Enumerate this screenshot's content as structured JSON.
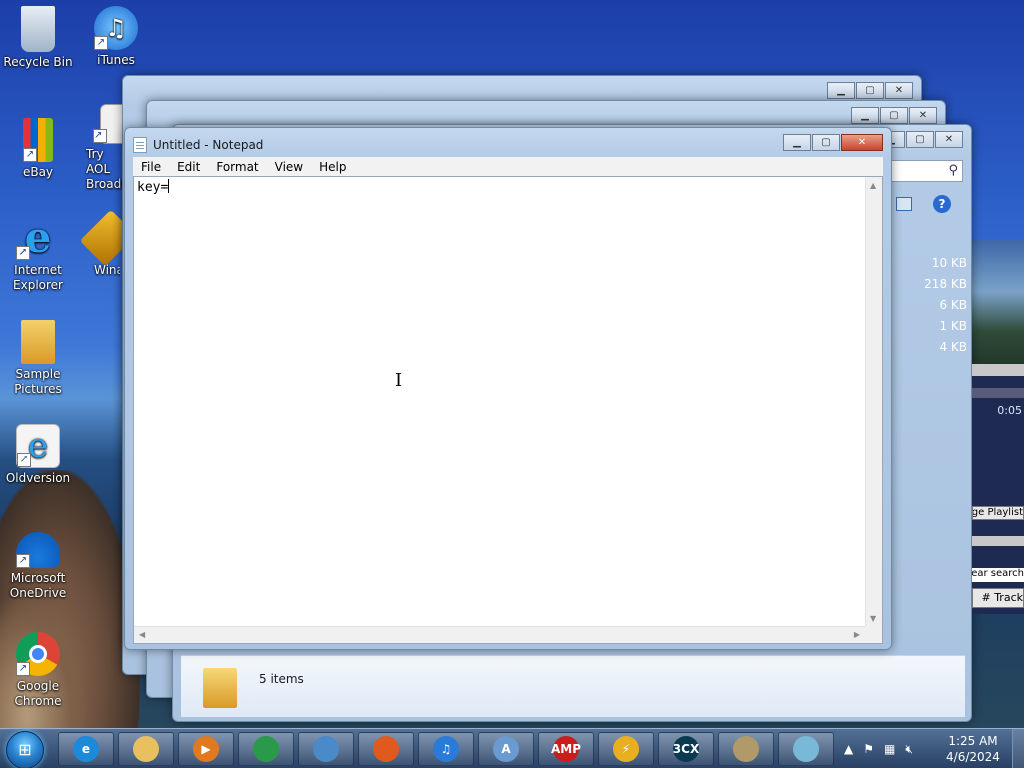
{
  "desktop": {
    "icons": [
      {
        "label": "Recycle Bin"
      },
      {
        "label": "iTunes"
      },
      {
        "label": "eBay"
      },
      {
        "label": "Try AOL Broadband"
      },
      {
        "label": "Internet Explorer"
      },
      {
        "label": "Winamp"
      },
      {
        "label": "Sample Pictures"
      },
      {
        "label": "Oldversion"
      },
      {
        "label": "Microsoft OneDrive"
      },
      {
        "label": "Google Chrome"
      }
    ]
  },
  "notepad": {
    "title": "Untitled - Notepad",
    "menu": [
      "File",
      "Edit",
      "Format",
      "View",
      "Help"
    ],
    "content": "key="
  },
  "explorer": {
    "file_sizes": [
      "10 KB",
      "218 KB",
      "6 KB",
      "1 KB",
      "4 KB"
    ],
    "status": "5 items"
  },
  "winamp": {
    "time": "0:05",
    "manage_playlist": "Manage Playlist",
    "clear_search": "Clear search",
    "track_col": "Track #"
  },
  "taskbar": {
    "items": [
      {
        "icon": "internet-explorer-icon",
        "label": "e",
        "color": "#1c8ad8"
      },
      {
        "icon": "windows-explorer-icon",
        "label": "",
        "color": "#e8c060"
      },
      {
        "icon": "media-player-icon",
        "label": "▶",
        "color": "#e07a20"
      },
      {
        "icon": "chrome-icon",
        "label": "",
        "color": "#2a9a4a"
      },
      {
        "icon": "control-panel-icon",
        "label": "",
        "color": "#4a8ac8"
      },
      {
        "icon": "firefox-icon",
        "label": "",
        "color": "#e05a20"
      },
      {
        "icon": "itunes-icon",
        "label": "♫",
        "color": "#2a7ad8"
      },
      {
        "icon": "wordpad-icon",
        "label": "A",
        "color": "#6a9ad0"
      },
      {
        "icon": "winamp-icon",
        "label": "AMP",
        "color": "#c81e1e"
      },
      {
        "icon": "winamp-lightning-icon",
        "label": "⚡",
        "color": "#e8b020"
      },
      {
        "icon": "3cx-icon",
        "label": "3CX",
        "color": "#0a3a50"
      },
      {
        "icon": "keys-icon",
        "label": "",
        "color": "#b09a6a"
      },
      {
        "icon": "notepad-icon",
        "label": "",
        "color": "#7ab8d8"
      }
    ],
    "time": "1:25 AM",
    "date": "4/6/2024"
  }
}
